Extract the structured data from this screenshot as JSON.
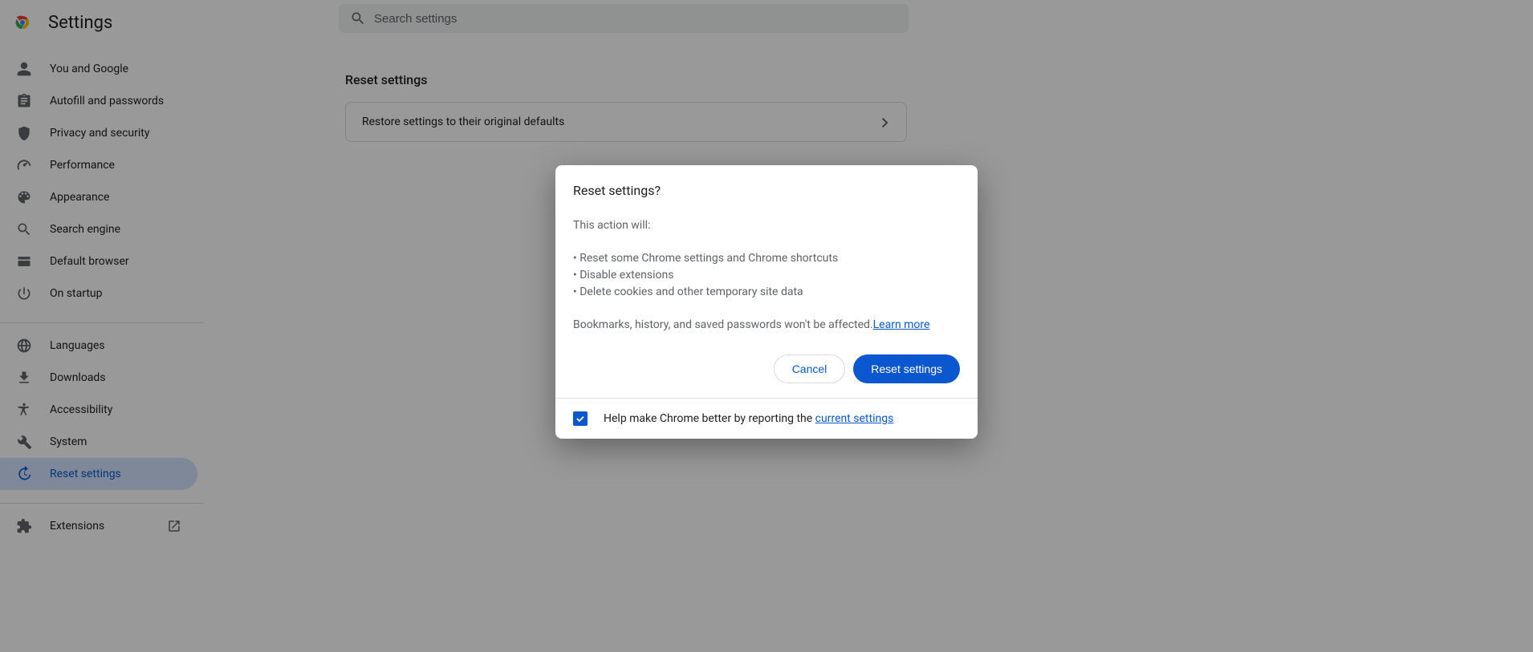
{
  "header": {
    "title": "Settings",
    "search_placeholder": "Search settings"
  },
  "sidebar": {
    "primary": [
      {
        "label": "You and Google",
        "icon": "person"
      },
      {
        "label": "Autofill and passwords",
        "icon": "assignment"
      },
      {
        "label": "Privacy and security",
        "icon": "shield"
      },
      {
        "label": "Performance",
        "icon": "speed"
      },
      {
        "label": "Appearance",
        "icon": "palette"
      },
      {
        "label": "Search engine",
        "icon": "search"
      },
      {
        "label": "Default browser",
        "icon": "browser"
      },
      {
        "label": "On startup",
        "icon": "power"
      }
    ],
    "secondary": [
      {
        "label": "Languages",
        "icon": "globe"
      },
      {
        "label": "Downloads",
        "icon": "download"
      },
      {
        "label": "Accessibility",
        "icon": "accessibility"
      },
      {
        "label": "System",
        "icon": "wrench"
      },
      {
        "label": "Reset settings",
        "icon": "history",
        "active": true
      }
    ],
    "extensions_label": "Extensions"
  },
  "main": {
    "section_title": "Reset settings",
    "row_label": "Restore settings to their original defaults"
  },
  "dialog": {
    "title": "Reset settings?",
    "intro": "This action will:",
    "bullets": [
      "Reset some Chrome settings and Chrome shortcuts",
      "Disable extensions",
      "Delete cookies and other temporary site data"
    ],
    "unaffected_text": "Bookmarks, history, and saved passwords won't be affected.",
    "learn_more": "Learn more",
    "cancel_label": "Cancel",
    "confirm_label": "Reset settings",
    "footer_text": "Help make Chrome better by reporting the ",
    "footer_link": "current settings",
    "checkbox_checked": true
  },
  "colors": {
    "accent": "#0b57d0",
    "scrim": "rgba(0,0,0,0.40)"
  }
}
